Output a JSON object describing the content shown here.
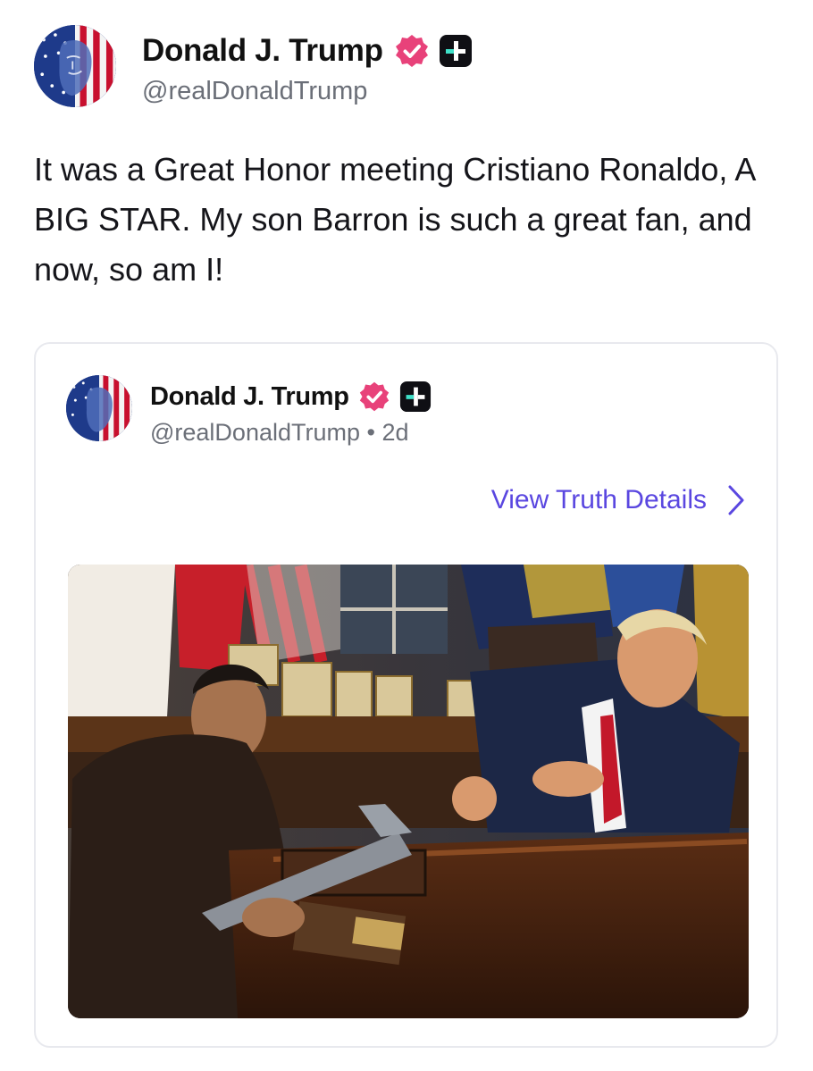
{
  "post": {
    "author": {
      "name": "Donald J. Trump",
      "handle": "@realDonaldTrump",
      "verified_color": "#e8427a",
      "plus_badge_color": "#0f0f14"
    },
    "text": "It was a Great Honor meeting Cristiano Ronaldo, A BIG STAR. My son Barron is such a great fan, and now, so am I!"
  },
  "quoted": {
    "author": {
      "name": "Donald J. Trump",
      "handle": "@realDonaldTrump",
      "age": "• 2d"
    },
    "view_details_label": "View Truth Details",
    "accent_color": "#5a47e0",
    "icons": [
      "verified-badge-icon",
      "plus-badge-icon",
      "chevron-right-icon"
    ]
  }
}
